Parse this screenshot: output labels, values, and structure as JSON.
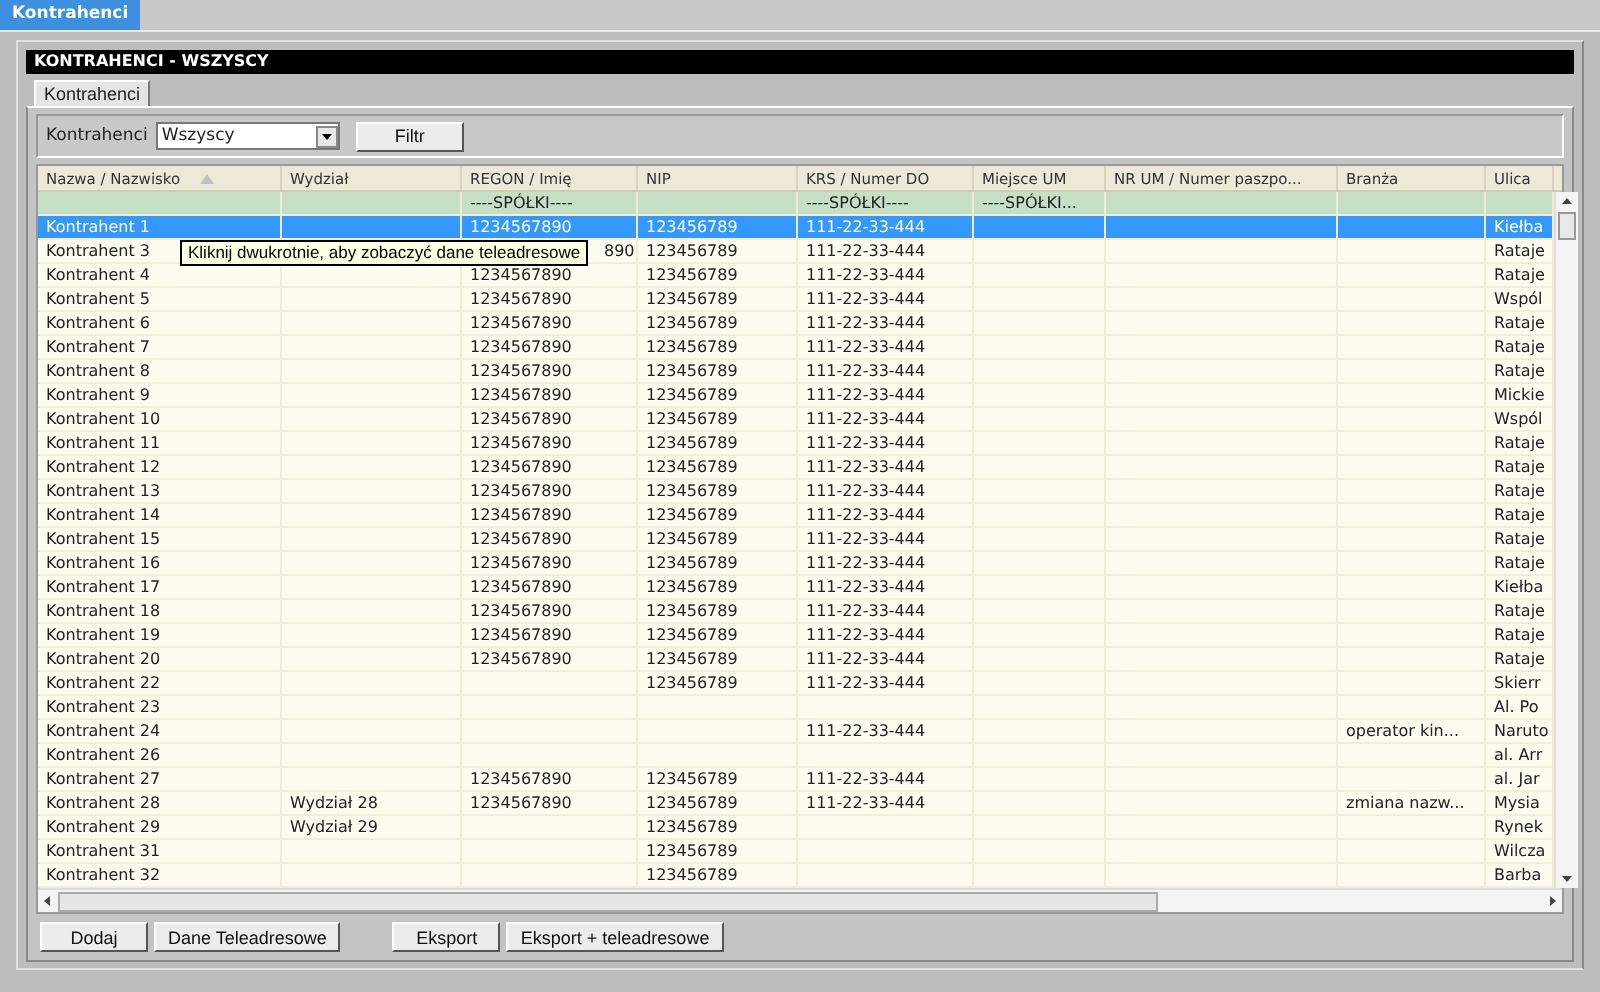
{
  "top_tabs": [
    {
      "label": "Kontrahenci",
      "selected": true
    }
  ],
  "panel_title": "KONTRAHENCI - WSZYSCY",
  "sub_tabs": [
    {
      "label": "Kontrahenci",
      "selected": true
    }
  ],
  "filter": {
    "label": "Kontrahenci",
    "value": "Wszyscy",
    "button": "Filtr"
  },
  "table": {
    "columns": [
      {
        "label": "Nazwa / Nazwisko",
        "sorted": true
      },
      {
        "label": "Wydział",
        "sorted": false
      },
      {
        "label": "REGON / Imię",
        "sorted": false
      },
      {
        "label": "NIP",
        "sorted": false
      },
      {
        "label": "KRS / Numer DO",
        "sorted": false
      },
      {
        "label": "Miejsce UM",
        "sorted": false
      },
      {
        "label": "NR UM / Numer paszpo...",
        "sorted": false
      },
      {
        "label": "Branża",
        "sorted": false
      },
      {
        "label": "Ulica",
        "sorted": false
      }
    ],
    "rows": [
      {
        "kind": "group",
        "selected": false,
        "cells": [
          null,
          null,
          "----SPÓŁKI----",
          null,
          "----SPÓŁKI----",
          "----SPÓŁKI...",
          null,
          null,
          null
        ]
      },
      {
        "kind": "data",
        "selected": true,
        "cells": [
          "Kontrahent 1",
          null,
          "1234567890",
          "123456789",
          "111-22-33-444",
          null,
          null,
          null,
          "Kiełba"
        ]
      },
      {
        "kind": "data",
        "selected": false,
        "cells": [
          "Kontrahent 3",
          null,
          "890",
          "123456789",
          "111-22-33-444",
          null,
          null,
          null,
          "Rataje"
        ]
      },
      {
        "kind": "data",
        "selected": false,
        "cells": [
          "Kontrahent 4",
          null,
          "1234567890",
          "123456789",
          "111-22-33-444",
          null,
          null,
          null,
          "Rataje"
        ]
      },
      {
        "kind": "data",
        "selected": false,
        "cells": [
          "Kontrahent 5",
          null,
          "1234567890",
          "123456789",
          "111-22-33-444",
          null,
          null,
          null,
          "Wspól"
        ]
      },
      {
        "kind": "data",
        "selected": false,
        "cells": [
          "Kontrahent 6",
          null,
          "1234567890",
          "123456789",
          "111-22-33-444",
          null,
          null,
          null,
          "Rataje"
        ]
      },
      {
        "kind": "data",
        "selected": false,
        "cells": [
          "Kontrahent 7",
          null,
          "1234567890",
          "123456789",
          "111-22-33-444",
          null,
          null,
          null,
          "Rataje"
        ]
      },
      {
        "kind": "data",
        "selected": false,
        "cells": [
          "Kontrahent 8",
          null,
          "1234567890",
          "123456789",
          "111-22-33-444",
          null,
          null,
          null,
          "Rataje"
        ]
      },
      {
        "kind": "data",
        "selected": false,
        "cells": [
          "Kontrahent 9",
          null,
          "1234567890",
          "123456789",
          "111-22-33-444",
          null,
          null,
          null,
          "Mickie"
        ]
      },
      {
        "kind": "data",
        "selected": false,
        "cells": [
          "Kontrahent 10",
          null,
          "1234567890",
          "123456789",
          "111-22-33-444",
          null,
          null,
          null,
          "Wspól"
        ]
      },
      {
        "kind": "data",
        "selected": false,
        "cells": [
          "Kontrahent 11",
          null,
          "1234567890",
          "123456789",
          "111-22-33-444",
          null,
          null,
          null,
          "Rataje"
        ]
      },
      {
        "kind": "data",
        "selected": false,
        "cells": [
          "Kontrahent 12",
          null,
          "1234567890",
          "123456789",
          "111-22-33-444",
          null,
          null,
          null,
          "Rataje"
        ]
      },
      {
        "kind": "data",
        "selected": false,
        "cells": [
          "Kontrahent 13",
          null,
          "1234567890",
          "123456789",
          "111-22-33-444",
          null,
          null,
          null,
          "Rataje"
        ]
      },
      {
        "kind": "data",
        "selected": false,
        "cells": [
          "Kontrahent 14",
          null,
          "1234567890",
          "123456789",
          "111-22-33-444",
          null,
          null,
          null,
          "Rataje"
        ]
      },
      {
        "kind": "data",
        "selected": false,
        "cells": [
          "Kontrahent 15",
          null,
          "1234567890",
          "123456789",
          "111-22-33-444",
          null,
          null,
          null,
          "Rataje"
        ]
      },
      {
        "kind": "data",
        "selected": false,
        "cells": [
          "Kontrahent 16",
          null,
          "1234567890",
          "123456789",
          "111-22-33-444",
          null,
          null,
          null,
          "Rataje"
        ]
      },
      {
        "kind": "data",
        "selected": false,
        "cells": [
          "Kontrahent 17",
          null,
          "1234567890",
          "123456789",
          "111-22-33-444",
          null,
          null,
          null,
          "Kiełba"
        ]
      },
      {
        "kind": "data",
        "selected": false,
        "cells": [
          "Kontrahent 18",
          null,
          "1234567890",
          "123456789",
          "111-22-33-444",
          null,
          null,
          null,
          "Rataje"
        ]
      },
      {
        "kind": "data",
        "selected": false,
        "cells": [
          "Kontrahent 19",
          null,
          "1234567890",
          "123456789",
          "111-22-33-444",
          null,
          null,
          null,
          "Rataje"
        ]
      },
      {
        "kind": "data",
        "selected": false,
        "cells": [
          "Kontrahent 20",
          null,
          "1234567890",
          "123456789",
          "111-22-33-444",
          null,
          null,
          null,
          "Rataje"
        ]
      },
      {
        "kind": "data",
        "selected": false,
        "cells": [
          "Kontrahent 22",
          null,
          null,
          "123456789",
          "111-22-33-444",
          null,
          null,
          null,
          "Skierr"
        ]
      },
      {
        "kind": "data",
        "selected": false,
        "cells": [
          "Kontrahent 23",
          null,
          null,
          null,
          null,
          null,
          null,
          null,
          "Al. Po"
        ]
      },
      {
        "kind": "data",
        "selected": false,
        "cells": [
          "Kontrahent 24",
          null,
          null,
          null,
          "111-22-33-444",
          null,
          null,
          "operator kin...",
          "Naruto"
        ]
      },
      {
        "kind": "data",
        "selected": false,
        "cells": [
          "Kontrahent 26",
          null,
          null,
          null,
          null,
          null,
          null,
          null,
          "al. Arr"
        ]
      },
      {
        "kind": "data",
        "selected": false,
        "cells": [
          "Kontrahent 27",
          null,
          "1234567890",
          "123456789",
          "111-22-33-444",
          null,
          null,
          null,
          "al. Jar"
        ]
      },
      {
        "kind": "data",
        "selected": false,
        "cells": [
          "Kontrahent 28",
          "Wydział 28",
          "1234567890",
          "123456789",
          "111-22-33-444",
          null,
          null,
          "zmiana nazw...",
          "Mysia"
        ]
      },
      {
        "kind": "data",
        "selected": false,
        "cells": [
          "Kontrahent 29",
          "Wydział 29",
          null,
          "123456789",
          null,
          null,
          null,
          null,
          "Rynek"
        ]
      },
      {
        "kind": "data",
        "selected": false,
        "cells": [
          "Kontrahent 31",
          null,
          null,
          "123456789",
          null,
          null,
          null,
          null,
          "Wilcza"
        ]
      },
      {
        "kind": "data",
        "selected": false,
        "cells": [
          "Kontrahent 32",
          null,
          null,
          "123456789",
          null,
          null,
          null,
          null,
          "Barba"
        ]
      }
    ]
  },
  "tooltip": "Kliknij dwukrotnie, aby zobaczyć dane teleadresowe",
  "button_groups": [
    [
      "Dodaj",
      "Dane Teleadresowe"
    ],
    [
      "Eksport",
      "Eksport + teleadresowe"
    ]
  ]
}
